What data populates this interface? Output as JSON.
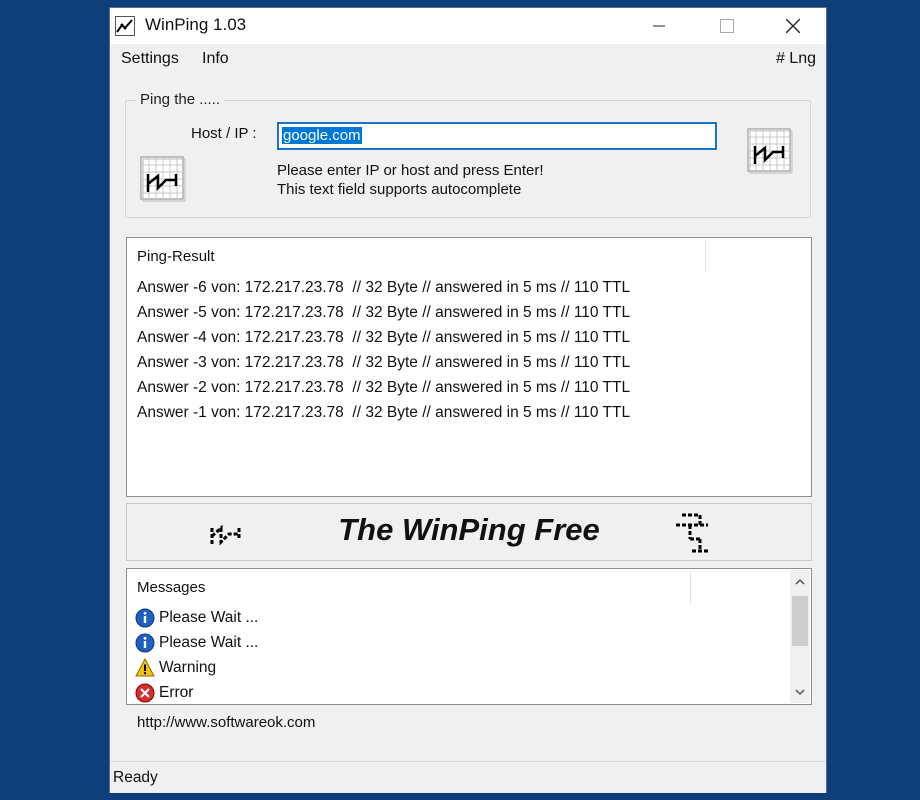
{
  "window": {
    "title": "WinPing 1.03",
    "icon": "winping-app-icon"
  },
  "menu": {
    "settings": "Settings",
    "info": "Info",
    "language": "# Lng"
  },
  "ping_group": {
    "legend": "Ping the .....",
    "host_label": "Host / IP :",
    "host_value": "google.com",
    "hint_line1": "Please enter IP or host and press Enter!",
    "hint_line2": "This text field supports autocomplete"
  },
  "results": {
    "header": "Ping-Result",
    "lines": [
      "Answer -6 von: 172.217.23.78  // 32 Byte // answered in 5 ms // 110 TTL",
      "Answer -5 von: 172.217.23.78  // 32 Byte // answered in 5 ms // 110 TTL",
      "Answer -4 von: 172.217.23.78  // 32 Byte // answered in 5 ms // 110 TTL",
      "Answer -3 von: 172.217.23.78  // 32 Byte // answered in 5 ms // 110 TTL",
      "Answer -2 von: 172.217.23.78  // 32 Byte // answered in 5 ms // 110 TTL",
      "Answer -1 von: 172.217.23.78  // 32 Byte // answered in 5 ms // 110 TTL"
    ]
  },
  "banner": {
    "text": "The WinPing Free"
  },
  "messages": {
    "header": "Messages",
    "items": [
      {
        "type": "info",
        "icon": "info-icon",
        "text": "Please Wait ..."
      },
      {
        "type": "info",
        "icon": "info-icon",
        "text": "Please Wait ..."
      },
      {
        "type": "warning",
        "icon": "warning-icon",
        "text": "Warning"
      },
      {
        "type": "error",
        "icon": "error-icon",
        "text": "Error"
      }
    ]
  },
  "footer": {
    "url": "http://www.softwareok.com",
    "status": "Ready"
  },
  "colors": {
    "desktop": "#0e3f7b",
    "selection": "#0078d7",
    "input_focus_border": "#1a73c7",
    "info_icon": "#1f5fbf",
    "warning_icon": "#f4c20d",
    "error_icon": "#d32f2f"
  }
}
